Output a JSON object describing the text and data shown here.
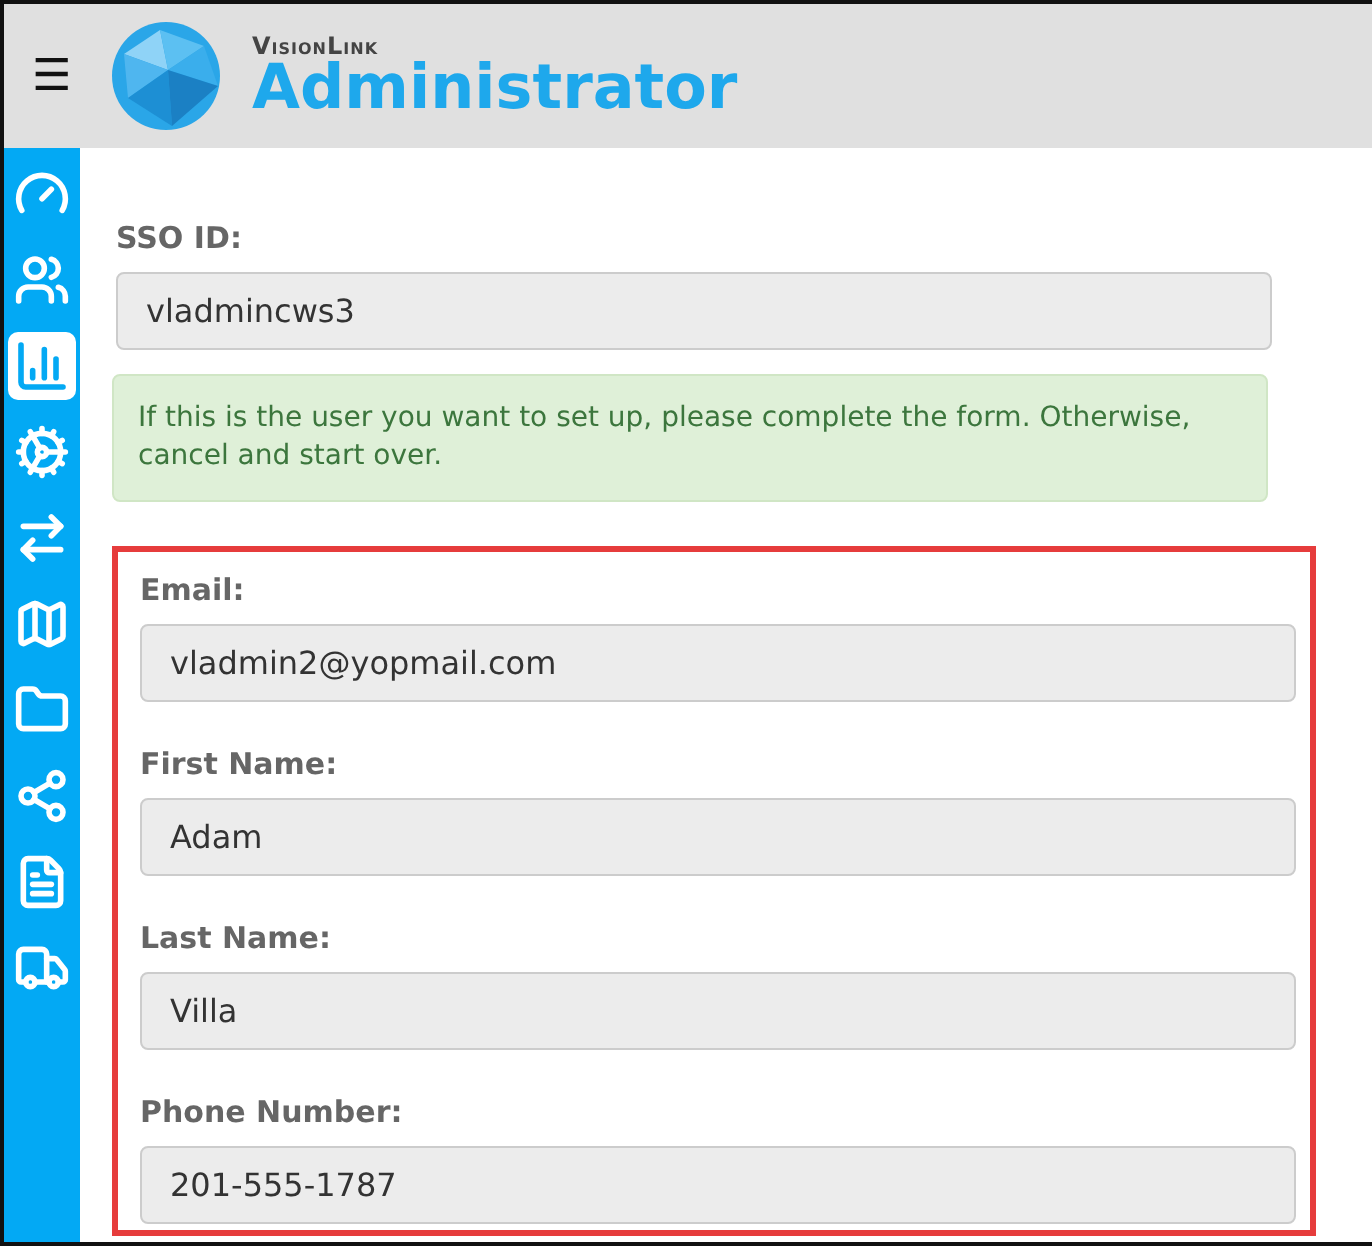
{
  "header": {
    "menu_icon": "☰",
    "brand_small": "VisionLink",
    "brand_title": "Administrator"
  },
  "sidebar": {
    "items": [
      {
        "kind": "gauge",
        "selected": false
      },
      {
        "kind": "users",
        "selected": false
      },
      {
        "kind": "chart",
        "selected": true
      },
      {
        "kind": "cogs",
        "selected": false
      },
      {
        "kind": "arrows",
        "selected": false
      },
      {
        "kind": "map",
        "selected": false
      },
      {
        "kind": "folder",
        "selected": false
      },
      {
        "kind": "share",
        "selected": false
      },
      {
        "kind": "document",
        "selected": false
      },
      {
        "kind": "truck",
        "selected": false
      }
    ]
  },
  "form": {
    "sso": {
      "label": "SSO ID:",
      "value": "vladmincws3"
    },
    "notice": "If this is the user you want to set up, please complete the form. Otherwise, cancel and start over.",
    "highlighted_fields": [
      {
        "label": "Email:",
        "value": "vladmin2@yopmail.com"
      },
      {
        "label": "First Name:",
        "value": "Adam"
      },
      {
        "label": "Last Name:",
        "value": "Villa"
      },
      {
        "label": "Phone Number:",
        "value": "201-555-1787"
      }
    ]
  }
}
